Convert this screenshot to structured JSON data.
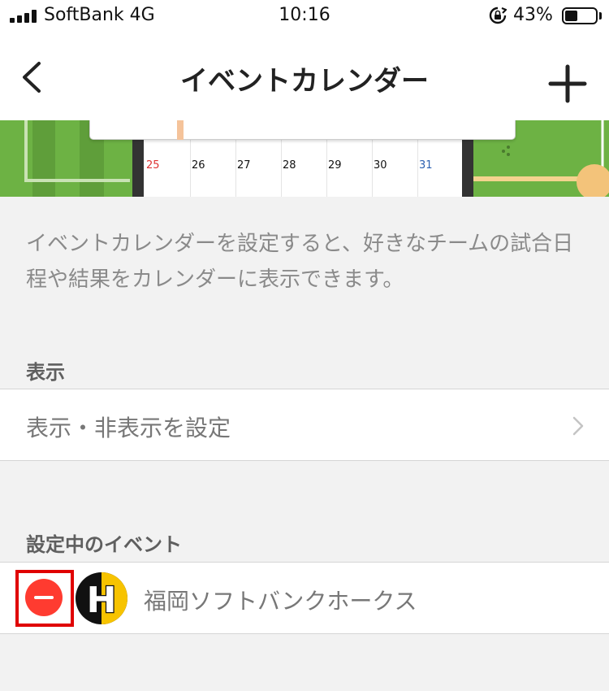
{
  "status_bar": {
    "carrier": "SoftBank 4G",
    "time": "10:16",
    "battery_percent": "43%",
    "battery_level": 0.43
  },
  "nav": {
    "title": "イベントカレンダー",
    "back_icon": "chevron-left-icon",
    "add_icon": "plus-icon"
  },
  "banner": {
    "days": [
      {
        "label": "25",
        "kind": "sun"
      },
      {
        "label": "26",
        "kind": "weekday"
      },
      {
        "label": "27",
        "kind": "weekday"
      },
      {
        "label": "28",
        "kind": "weekday"
      },
      {
        "label": "29",
        "kind": "weekday"
      },
      {
        "label": "30",
        "kind": "weekday"
      },
      {
        "label": "31",
        "kind": "sat"
      }
    ]
  },
  "description": "イベントカレンダーを設定すると、好きなチームの試合日程や結果をカレンダーに表示できます。",
  "display_section": {
    "header": "表示",
    "row_label": "表示・非表示を設定"
  },
  "events_section": {
    "header": "設定中のイベント",
    "items": [
      {
        "name": "福岡ソフトバンクホークス",
        "logo_letter": "H"
      }
    ]
  },
  "colors": {
    "remove": "#ff3b30",
    "highlight_box": "#e00000",
    "field_green": "#6db244",
    "logo_yellow": "#f7c300"
  }
}
